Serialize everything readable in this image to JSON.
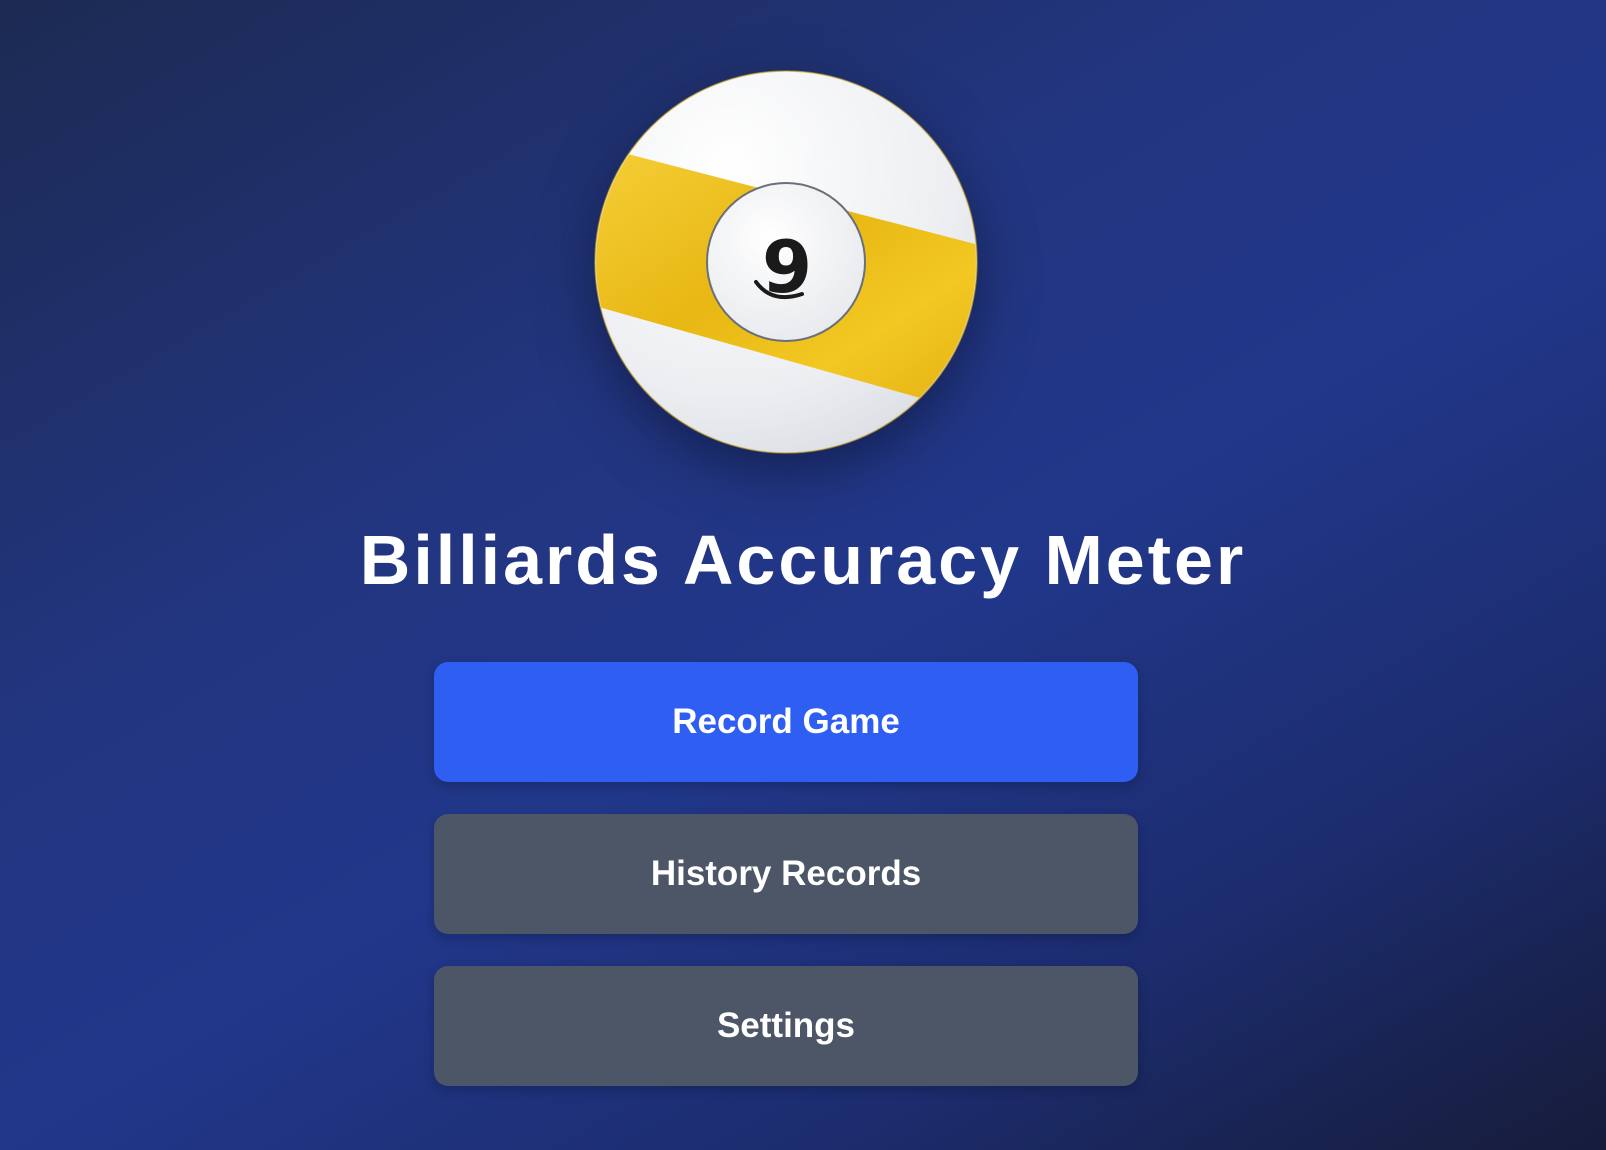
{
  "app": {
    "title": "Billiards Accuracy Meter",
    "logo_icon": "nine-ball-icon",
    "logo_number": "9"
  },
  "menu": {
    "items": [
      {
        "label": "Record Game",
        "variant": "primary"
      },
      {
        "label": "History Records",
        "variant": "secondary"
      },
      {
        "label": "Settings",
        "variant": "secondary"
      }
    ]
  },
  "colors": {
    "primary_button": "#2e5ef2",
    "secondary_button": "#4d5666",
    "ball_stripe": "#f2c21b",
    "ball_white": "#f3f4f6"
  }
}
